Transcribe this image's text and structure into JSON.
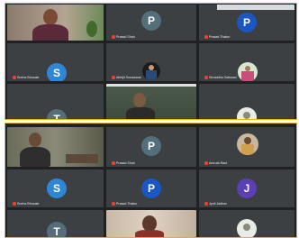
{
  "top": {
    "header_text": "",
    "tiles": [
      {
        "type": "video",
        "name": ""
      },
      {
        "type": "avatar",
        "initial": "P",
        "color": "#546e7a",
        "name": "Prasad Shah"
      },
      {
        "type": "avatar",
        "initial": "P",
        "color": "#1a56c4",
        "name": "Prasad Thakur"
      },
      {
        "type": "avatar",
        "initial": "S",
        "color": "#2f86d4",
        "name": "Sneha Bhosale"
      },
      {
        "type": "video",
        "name": "Abhijit Sonawane"
      },
      {
        "type": "video",
        "name": "Shraddha Gaikwad"
      },
      {
        "type": "avatar",
        "initial": "T",
        "color": "#546e7a",
        "name": ""
      },
      {
        "type": "video",
        "name": ""
      },
      {
        "type": "video",
        "name": ""
      }
    ]
  },
  "bottom": {
    "tiles": [
      {
        "type": "video",
        "name": ""
      },
      {
        "type": "avatar",
        "initial": "P",
        "color": "#546e7a",
        "name": "Prasad Shah"
      },
      {
        "type": "video",
        "name": "Amruta Raut"
      },
      {
        "type": "avatar",
        "initial": "S",
        "color": "#2f86d4",
        "name": "Sneha Bhosale"
      },
      {
        "type": "avatar",
        "initial": "P",
        "color": "#1a56c4",
        "name": "Prasad Thakur"
      },
      {
        "type": "avatar",
        "initial": "J",
        "color": "#5a3fb5",
        "name": "Jyoti Jadhav"
      },
      {
        "type": "avatar",
        "initial": "T",
        "color": "#546e7a",
        "name": ""
      },
      {
        "type": "video",
        "name": ""
      },
      {
        "type": "video",
        "name": ""
      }
    ]
  }
}
